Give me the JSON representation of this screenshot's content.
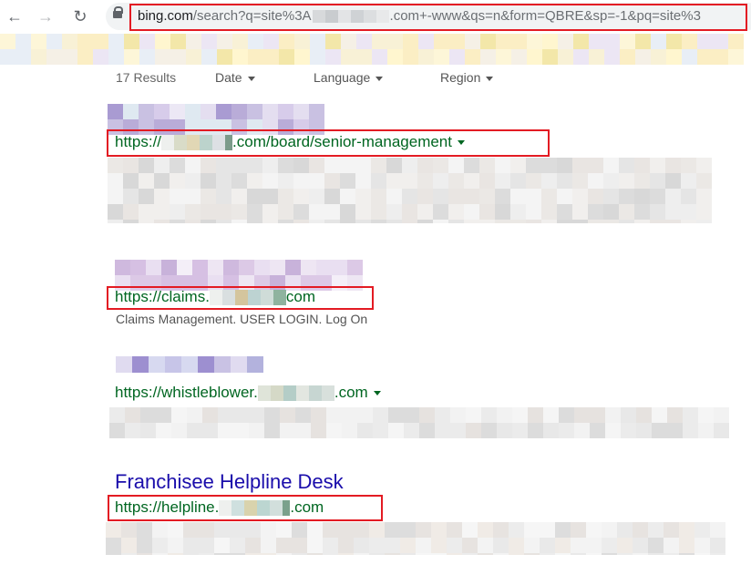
{
  "browser": {
    "back_icon": "arrow-left-icon",
    "forward_icon": "arrow-right-icon",
    "reload_icon": "reload-icon",
    "lock_icon": "lock-icon",
    "url_host": "bing.com",
    "url_path_start": "/search?q=site%3A",
    "url_path_end": ".com+-www&qs=n&form=QBRE&sp=-1&pq=site%3"
  },
  "filters": {
    "results_count": "17 Results",
    "date_label": "Date",
    "language_label": "Language",
    "region_label": "Region"
  },
  "results": [
    {
      "url_prefix": "https://",
      "url_suffix": ".com/board/senior-management"
    },
    {
      "url_prefix": "https://claims.",
      "url_suffix": "com",
      "snippet": "Claims Management. USER LOGIN. Log On"
    },
    {
      "url_prefix": "https://whistleblower.",
      "url_suffix": ".com"
    },
    {
      "title": "Franchisee Helpline Desk",
      "url_prefix": "https://helpline.",
      "url_suffix": ".com"
    }
  ],
  "colors": {
    "result_url": "#006621",
    "result_title": "#1a0dab",
    "highlight_box": "#e31b23"
  }
}
